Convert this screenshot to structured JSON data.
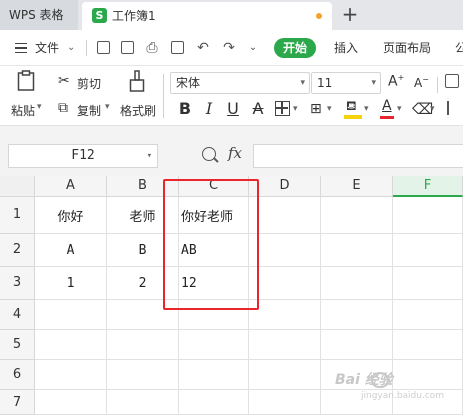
{
  "titlebar": {
    "app_tab": "WPS 表格",
    "doc_logo": "S",
    "doc_tab": "工作簿1",
    "new_tab_icon": "plus-icon",
    "unsaved_dot_color": "#f0a429"
  },
  "menu": {
    "file": "文件",
    "tabs": [
      "开始",
      "插入",
      "页面布局",
      "公"
    ],
    "active_tab_color": "#2aa84a"
  },
  "toolbar": {
    "paste": "粘贴",
    "cut": "剪切",
    "copy": "复制",
    "format_painter": "格式刷",
    "font_name": "宋体",
    "font_size": "11",
    "bold": "B",
    "italic": "I",
    "underline": "U",
    "font_color_letter": "A",
    "font_color": "#e8262b",
    "fill_color": "#f5d20a"
  },
  "formula_bar": {
    "cell_ref": "F12",
    "fx": "fx",
    "formula": ""
  },
  "grid": {
    "columns": [
      "A",
      "B",
      "C",
      "D",
      "E",
      "F"
    ],
    "selected_column": "F",
    "rows": [
      "1",
      "2",
      "3",
      "4",
      "5",
      "6",
      "7"
    ],
    "cells": {
      "A1": "你好",
      "B1": "老师",
      "C1": "你好老师",
      "A2": "A",
      "B2": "B",
      "C2": "AB",
      "A3": "1",
      "B3": "2",
      "C3": "12"
    },
    "highlight_color": "#e8262b"
  },
  "watermark": {
    "text": "Bai 经验",
    "sub": "jingyan.baidu.com"
  }
}
